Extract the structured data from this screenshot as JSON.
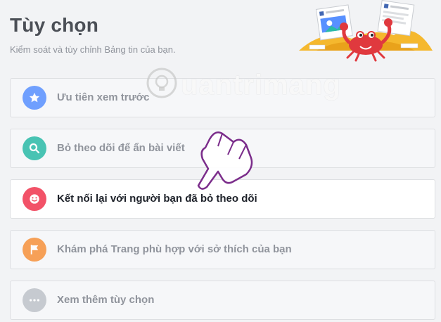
{
  "header": {
    "title": "Tùy chọn",
    "subtitle": "Kiểm soát và tùy chỉnh Bảng tin của bạn."
  },
  "watermark": {
    "text": "uantrimang"
  },
  "options": [
    {
      "label": "Ưu tiên xem trước",
      "icon": "star-icon",
      "color": "#5890ff",
      "state": "dimmed"
    },
    {
      "label": "Bỏ theo dõi để ẩn bài viết",
      "icon": "search-icon",
      "color": "#2abba7",
      "state": "dimmed"
    },
    {
      "label": "Kết nối lại với người bạn đã bỏ theo dõi",
      "icon": "smile-icon",
      "color": "#f25268",
      "state": "active"
    },
    {
      "label": "Khám phá Trang phù hợp với sở thích của bạn",
      "icon": "flag-icon",
      "color": "#f7923b",
      "state": "dimmed"
    },
    {
      "label": "Xem thêm tùy chọn",
      "icon": "more-icon",
      "color": "#bec3c9",
      "state": "dimmed"
    }
  ],
  "colors": {
    "background": "#f2f3f5",
    "title": "#4b4f56",
    "muted": "#90949c",
    "active_text": "#1d2129",
    "border": "#dddfe2"
  }
}
